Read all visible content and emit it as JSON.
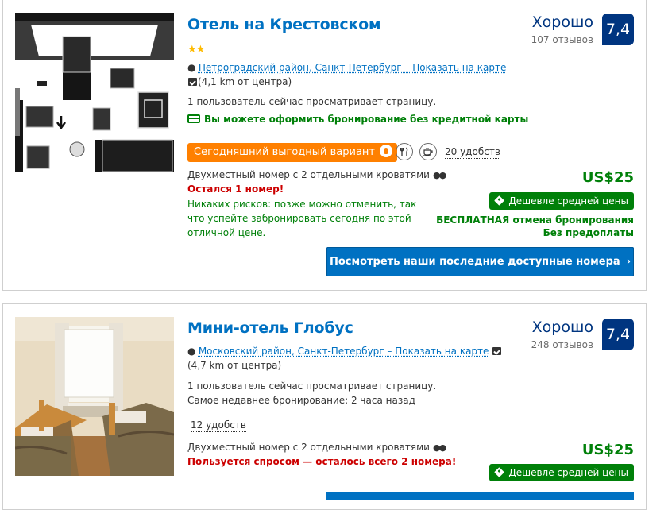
{
  "hotels": [
    {
      "name": "Отель на Крестовском",
      "stars": "★★",
      "pin_icon": "map-pin-icon",
      "address_link": "Петроградский район, Санкт-Петербург – Показать на карте",
      "distance": "(4,1 km от центра)",
      "viewing": "1 пользователь сейчас просматривает страницу.",
      "no_card": "Вы можете оформить бронирование без кредитной карты",
      "deal_badge": "Сегодняшний выгодный вариант",
      "amenities": [
        "restaurant-icon",
        "breakfast-icon"
      ],
      "facilities": "20 удобств",
      "room_type": "Двухместный номер с 2 отдельными кроватями",
      "urgency": "Остался 1 номер!",
      "no_risk": "Никаких рисков: позже можно отменить, так что успейте забронировать сегодня по этой отличной цене.",
      "review_word": "Хорошо",
      "review_count": "107 отзывов",
      "score": "7,4",
      "price": "US$25",
      "cheaper": "Дешевле средней цены",
      "free_cancel_bold": "БЕСПЛАТНАЯ",
      "free_cancel_rest": " отмена бронирования",
      "no_prepay": "Без предоплаты",
      "cta": "Посмотреть наши последние доступные номера",
      "cta_icon": "chevron-right-icon"
    },
    {
      "name": "Мини-отель Глобус",
      "pin_icon": "map-pin-icon",
      "address_link": "Московский район, Санкт-Петербург – Показать на карте",
      "distance": "(4,7 km от центра)",
      "viewing": "1 пользователь сейчас просматривает страницу.",
      "recent_booking": "Самое недавнее бронирование: 2 часа назад",
      "facilities": "12 удобств",
      "room_type": "Двухместный номер с 2 отдельными кроватями",
      "urgency": "Пользуется спросом — осталось всего 2 номера!",
      "review_word": "Хорошо",
      "review_count": "248 отзывов",
      "score": "7,4",
      "price": "US$25",
      "cheaper": "Дешевле средней цены"
    }
  ],
  "colors": {
    "link_blue": "#0071c2",
    "score_navy": "#003580",
    "deal_green": "#008009",
    "deal_orange": "#ff8000",
    "urgency_red": "#cc0000",
    "star_yellow": "#febb02"
  }
}
